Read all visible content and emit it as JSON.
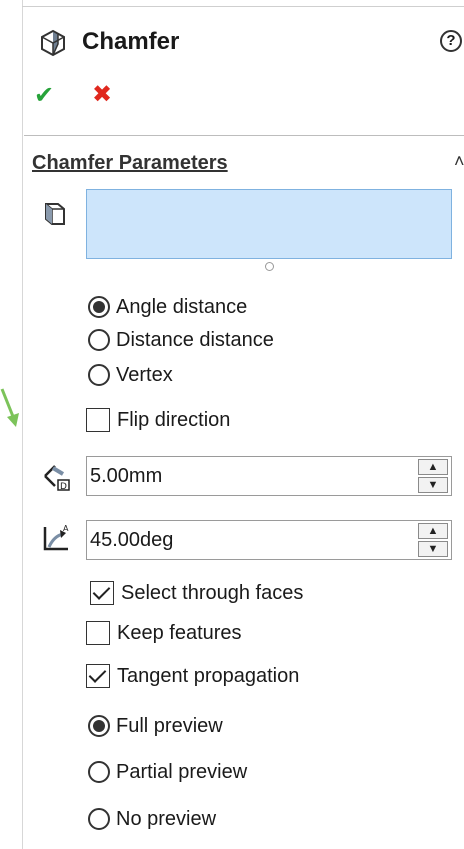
{
  "header": {
    "title": "Chamfer",
    "help_glyph": "?"
  },
  "actions": {
    "ok_glyph": "✔",
    "cancel_glyph": "✖"
  },
  "section": {
    "title": "Chamfer Parameters",
    "collapse_glyph": "˄"
  },
  "type_options": [
    {
      "label": "Angle distance",
      "selected": true
    },
    {
      "label": "Distance distance",
      "selected": false
    },
    {
      "label": "Vertex",
      "selected": false
    }
  ],
  "flip": {
    "label": "Flip direction",
    "checked": false
  },
  "distance": {
    "value": "5.00mm",
    "up_glyph": "▲",
    "down_glyph": "▼"
  },
  "angle": {
    "value": "45.00deg",
    "up_glyph": "▲",
    "down_glyph": "▼"
  },
  "options": [
    {
      "label": "Select through faces",
      "checked": true
    },
    {
      "label": "Keep features",
      "checked": false
    },
    {
      "label": "Tangent propagation",
      "checked": true
    }
  ],
  "preview_options": [
    {
      "label": "Full preview",
      "selected": true
    },
    {
      "label": "Partial preview",
      "selected": false
    },
    {
      "label": "No preview",
      "selected": false
    }
  ],
  "colors": {
    "accent_ok": "#27a33a",
    "accent_cancel": "#e0281e",
    "selection_box": "#cde5fb"
  }
}
